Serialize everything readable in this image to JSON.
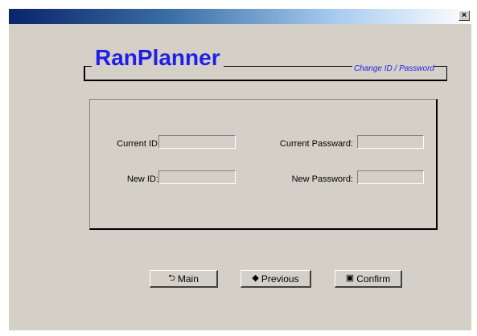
{
  "window": {
    "close_glyph": "×"
  },
  "header": {
    "brand": "RanPlanner",
    "subtitle": "Change ID / Password"
  },
  "form": {
    "current_id_label": "Current ID:",
    "current_id_value": "",
    "current_password_label": "Current Passward:",
    "current_password_value": "",
    "new_id_label": "New ID:",
    "new_id_value": "",
    "new_password_label": "New Password:",
    "new_password_value": ""
  },
  "buttons": {
    "main": {
      "label": "Main",
      "icon": "return-arrow-icon",
      "glyph": "⮌"
    },
    "previous": {
      "label": "Previous",
      "icon": "left-arrow-icon",
      "glyph": "◆"
    },
    "confirm": {
      "label": "Confirm",
      "icon": "floppy-disk-icon",
      "glyph": "▣"
    }
  },
  "colors": {
    "brand": "#1f1fe6",
    "window_bg": "#d4d0c8",
    "titlebar_start": "#0a246a"
  }
}
